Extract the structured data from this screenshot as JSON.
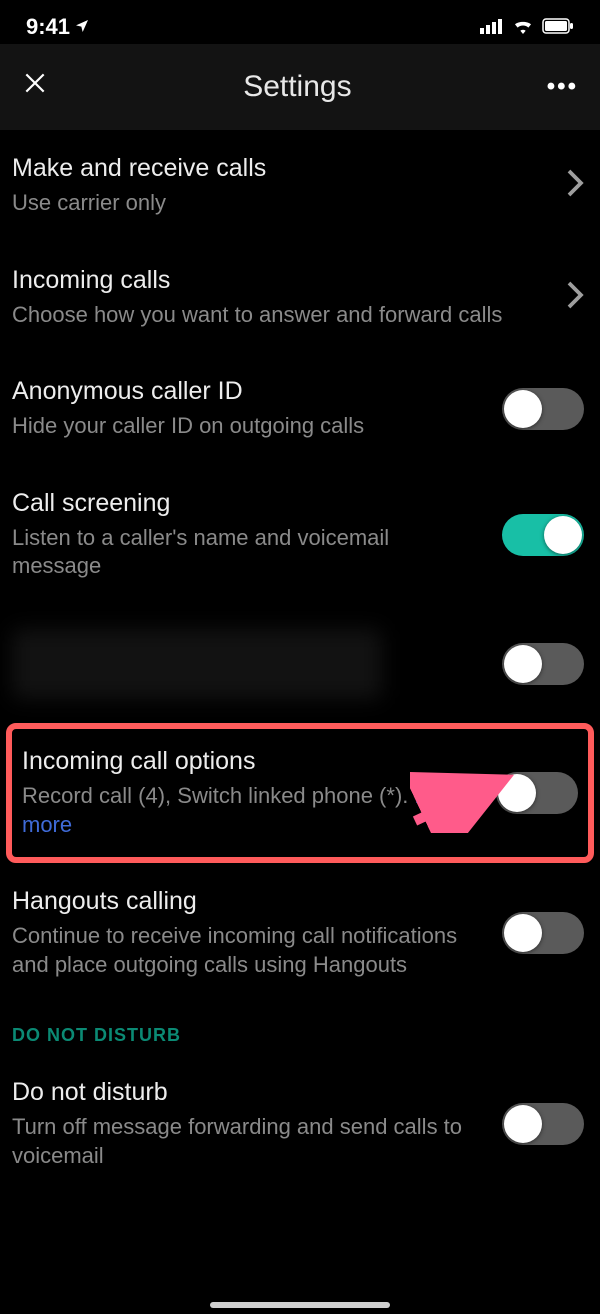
{
  "status": {
    "time": "9:41"
  },
  "header": {
    "title": "Settings"
  },
  "rows": {
    "make_receive": {
      "title": "Make and receive calls",
      "sub": "Use carrier only"
    },
    "incoming": {
      "title": "Incoming calls",
      "sub": "Choose how you want to answer and forward calls"
    },
    "anon": {
      "title": "Anonymous caller ID",
      "sub": "Hide your caller ID on outgoing calls",
      "on": false
    },
    "screening": {
      "title": "Call screening",
      "sub": "Listen to a caller's name and voicemail message",
      "on": true
    },
    "redacted": {
      "on": false
    },
    "options": {
      "title": "Incoming call options",
      "sub_a": "Record call (4), Switch linked phone (*). ",
      "link": "Learn more",
      "on": false
    },
    "hangouts": {
      "title": "Hangouts calling",
      "sub": "Continue to receive incoming call notifications and place outgoing calls using Hangouts",
      "on": false
    },
    "dnd_section": "DO NOT DISTURB",
    "dnd": {
      "title": "Do not disturb",
      "sub": "Turn off message forwarding and send calls to voicemail",
      "on": false
    }
  }
}
